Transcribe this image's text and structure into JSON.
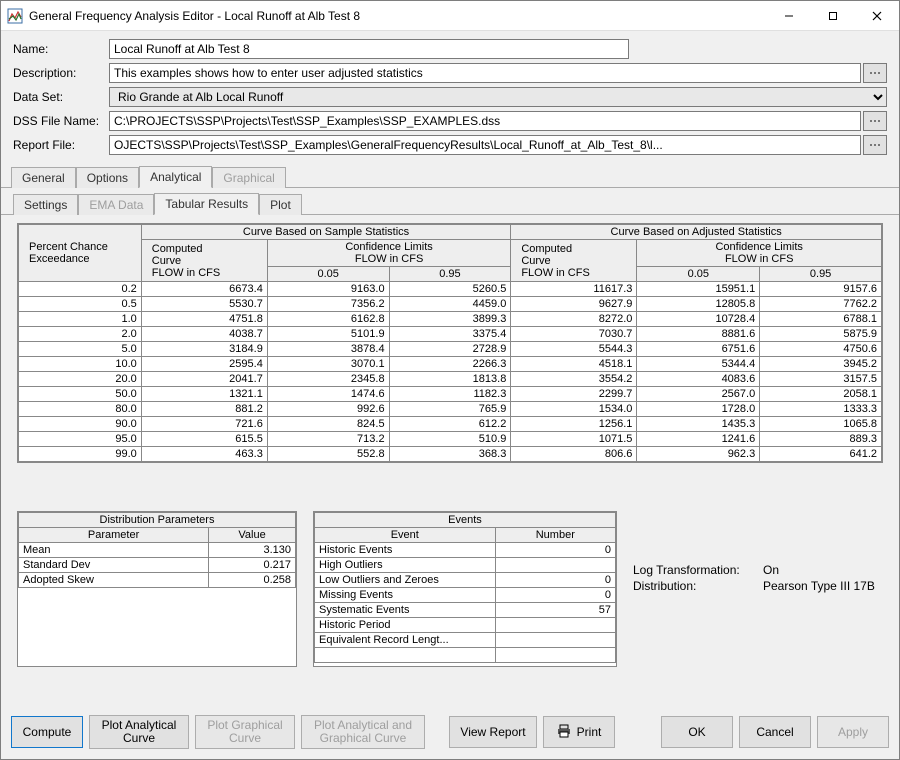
{
  "window": {
    "title": "General Frequency Analysis Editor - Local Runoff at Alb Test 8",
    "min_tooltip": "Minimize",
    "max_tooltip": "Maximize",
    "close_tooltip": "Close"
  },
  "form": {
    "name": {
      "label": "Name:",
      "value": "Local Runoff at Alb Test 8"
    },
    "description": {
      "label": "Description:",
      "value": "This examples shows how to enter user adjusted statistics"
    },
    "dataset": {
      "label": "Data Set:",
      "value": "Rio Grande at Alb Local Runoff"
    },
    "dssfile": {
      "label": "DSS File Name:",
      "value": "C:\\PROJECTS\\SSP\\Projects\\Test\\SSP_Examples\\SSP_EXAMPLES.dss"
    },
    "reportfile": {
      "label": "Report File:",
      "value": "OJECTS\\SSP\\Projects\\Test\\SSP_Examples\\GeneralFrequencyResults\\Local_Runoff_at_Alb_Test_8\\l..."
    }
  },
  "tabs": {
    "general": "General",
    "options": "Options",
    "analytical": "Analytical",
    "graphical": "Graphical"
  },
  "subtabs": {
    "settings": "Settings",
    "ema": "EMA Data",
    "tabular": "Tabular Results",
    "plot": "Plot"
  },
  "table": {
    "col1": "Percent Chance\nExceedance",
    "grp_sample": "Curve Based on Sample Statistics",
    "grp_adjusted": "Curve Based on Adjusted Statistics",
    "computed_label": "Computed\nCurve\nFLOW in CFS",
    "conf_label": "Confidence Limits\nFLOW in CFS",
    "conf_a": "0.05",
    "conf_b": "0.95",
    "rows": [
      {
        "p": "0.2",
        "c1": "6673.4",
        "a1": "9163.0",
        "b1": "5260.5",
        "c2": "11617.3",
        "a2": "15951.1",
        "b2": "9157.6"
      },
      {
        "p": "0.5",
        "c1": "5530.7",
        "a1": "7356.2",
        "b1": "4459.0",
        "c2": "9627.9",
        "a2": "12805.8",
        "b2": "7762.2"
      },
      {
        "p": "1.0",
        "c1": "4751.8",
        "a1": "6162.8",
        "b1": "3899.3",
        "c2": "8272.0",
        "a2": "10728.4",
        "b2": "6788.1"
      },
      {
        "p": "2.0",
        "c1": "4038.7",
        "a1": "5101.9",
        "b1": "3375.4",
        "c2": "7030.7",
        "a2": "8881.6",
        "b2": "5875.9"
      },
      {
        "p": "5.0",
        "c1": "3184.9",
        "a1": "3878.4",
        "b1": "2728.9",
        "c2": "5544.3",
        "a2": "6751.6",
        "b2": "4750.6"
      },
      {
        "p": "10.0",
        "c1": "2595.4",
        "a1": "3070.1",
        "b1": "2266.3",
        "c2": "4518.1",
        "a2": "5344.4",
        "b2": "3945.2"
      },
      {
        "p": "20.0",
        "c1": "2041.7",
        "a1": "2345.8",
        "b1": "1813.8",
        "c2": "3554.2",
        "a2": "4083.6",
        "b2": "3157.5"
      },
      {
        "p": "50.0",
        "c1": "1321.1",
        "a1": "1474.6",
        "b1": "1182.3",
        "c2": "2299.7",
        "a2": "2567.0",
        "b2": "2058.1"
      },
      {
        "p": "80.0",
        "c1": "881.2",
        "a1": "992.6",
        "b1": "765.9",
        "c2": "1534.0",
        "a2": "1728.0",
        "b2": "1333.3"
      },
      {
        "p": "90.0",
        "c1": "721.6",
        "a1": "824.5",
        "b1": "612.2",
        "c2": "1256.1",
        "a2": "1435.3",
        "b2": "1065.8"
      },
      {
        "p": "95.0",
        "c1": "615.5",
        "a1": "713.2",
        "b1": "510.9",
        "c2": "1071.5",
        "a2": "1241.6",
        "b2": "889.3"
      },
      {
        "p": "99.0",
        "c1": "463.3",
        "a1": "552.8",
        "b1": "368.3",
        "c2": "806.6",
        "a2": "962.3",
        "b2": "641.2"
      }
    ]
  },
  "dist": {
    "title": "Distribution Parameters",
    "col_param": "Parameter",
    "col_val": "Value",
    "rows": [
      {
        "p": "Mean",
        "v": "3.130"
      },
      {
        "p": "Standard Dev",
        "v": "0.217"
      },
      {
        "p": "Adopted Skew",
        "v": "0.258"
      }
    ]
  },
  "events": {
    "title": "Events",
    "col_event": "Event",
    "col_num": "Number",
    "rows": [
      {
        "e": "Historic Events",
        "n": "0"
      },
      {
        "e": "High Outliers",
        "n": ""
      },
      {
        "e": "Low Outliers and Zeroes",
        "n": "0"
      },
      {
        "e": "Missing Events",
        "n": "0"
      },
      {
        "e": "Systematic Events",
        "n": "57"
      },
      {
        "e": "Historic Period",
        "n": ""
      },
      {
        "e": "Equivalent Record Lengt...",
        "n": ""
      }
    ]
  },
  "props": {
    "logt": {
      "label": "Log Transformation:",
      "value": "On"
    },
    "dist": {
      "label": "Distribution:",
      "value": "Pearson Type III 17B"
    }
  },
  "buttons": {
    "compute": "Compute",
    "plot_analytical": "Plot Analytical Curve",
    "plot_graphical": "Plot Graphical Curve",
    "plot_both": "Plot Analytical and Graphical Curve",
    "view_report": "View Report",
    "print": "Print",
    "ok": "OK",
    "cancel": "Cancel",
    "apply": "Apply"
  }
}
